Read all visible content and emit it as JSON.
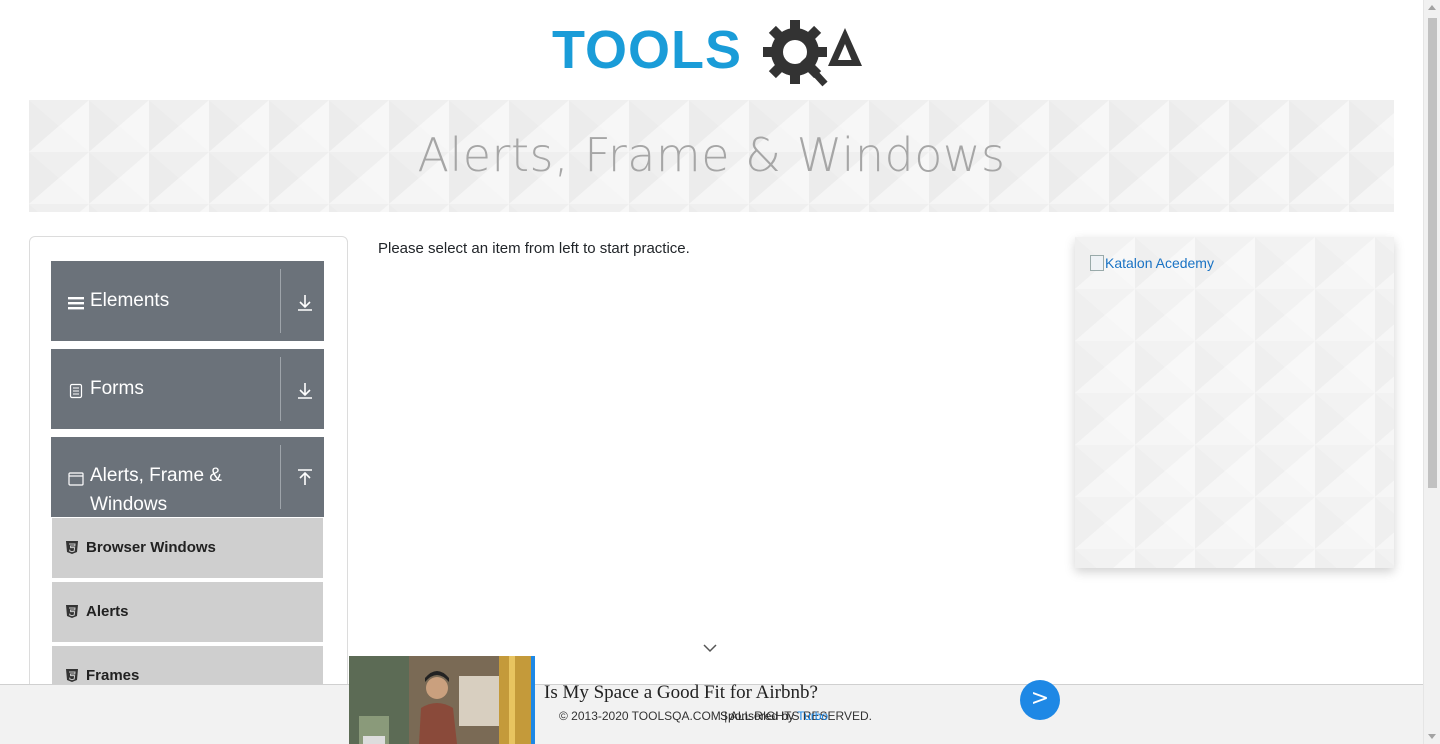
{
  "header": {
    "logo_text_primary": "TOOLS",
    "logo_text_secondary": "QA"
  },
  "banner": {
    "title": "Alerts, Frame & Windows"
  },
  "sidebar": {
    "groups": [
      {
        "label": "Elements",
        "icon": "hamburger-icon",
        "expanded": false
      },
      {
        "label": "Forms",
        "icon": "document-icon",
        "expanded": false
      },
      {
        "label": "Alerts, Frame & Windows",
        "label_line1": "Alerts, Frame &",
        "label_line2": "Windows",
        "icon": "window-icon",
        "expanded": true
      }
    ],
    "items": [
      {
        "label": "Browser Windows",
        "icon": "html5-icon"
      },
      {
        "label": "Alerts",
        "icon": "html5-icon"
      },
      {
        "label": "Frames",
        "icon": "html5-icon"
      }
    ]
  },
  "main": {
    "message": "Please select an item from left to start practice."
  },
  "ad_card": {
    "alt_text": "Katalon Acedemy"
  },
  "footer": {
    "copyright": "© 2013-2020 TOOLSQA.COM | ALL RIGHTS RESERVED."
  },
  "bottom_ad": {
    "headline": "Is My Space a Good Fit for Airbnb?",
    "sponsored_prefix": "Sponsored by",
    "sponsor": "Turbo",
    "cta": ">"
  },
  "colors": {
    "logo_blue": "#1a9cd8",
    "logo_dark": "#3a3a3a",
    "sidebar_group": "#6b727a",
    "sidebar_item": "#cfcfcf",
    "accent_blue": "#1e88e5"
  }
}
